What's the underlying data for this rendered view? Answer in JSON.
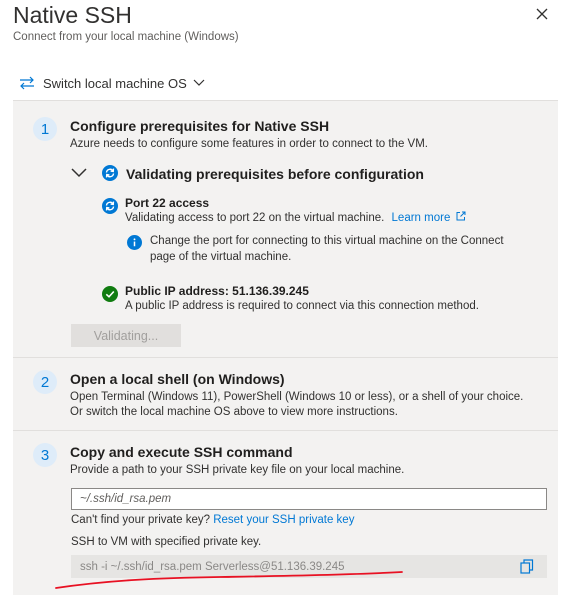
{
  "header": {
    "title": "Native SSH",
    "subtitle": "Connect from your local machine (Windows)"
  },
  "switch_os": {
    "label": "Switch local machine OS"
  },
  "steps": [
    {
      "number": "1",
      "title": "Configure prerequisites for Native SSH",
      "description": "Azure needs to configure some features in order to connect to the VM.",
      "validation": {
        "title": "Validating prerequisites before configuration",
        "port": {
          "title": "Port 22 access",
          "description": "Validating access to port 22 on the virtual machine.",
          "learn_more": "Learn more",
          "info_line1": "Change the port for connecting to this virtual machine on the Connect",
          "info_line2": "page of the virtual machine."
        },
        "public_ip": {
          "title": "Public IP address: 51.136.39.245",
          "description": "A public IP address is required to connect via this connection method."
        }
      },
      "button_label": "Validating..."
    },
    {
      "number": "2",
      "title": "Open a local shell (on Windows)",
      "line1": "Open Terminal (Windows 11), PowerShell (Windows 10 or less), or a shell of your choice.",
      "line2": "Or switch the local machine OS above to view more instructions."
    },
    {
      "number": "3",
      "title": "Copy and execute SSH command",
      "description": "Provide a path to your SSH private key file on your local machine.",
      "key_path_value": "~/.ssh/id_rsa.pem",
      "cant_find_text": "Can't find your private key?",
      "reset_link": "Reset your SSH private key",
      "ssh_label": "SSH to VM with specified private key.",
      "command": "ssh -i ~/.ssh/id_rsa.pem Serverless@51.136.39.245"
    }
  ],
  "colors": {
    "accent": "#0078d4",
    "success": "#107c10",
    "panel_background": "#f3f2f1",
    "annotation_red": "#e81123"
  },
  "icons": {
    "close": "close-icon",
    "switch": "swap-arrows-icon",
    "chevron": "chevron-down-icon",
    "validating": "sync-icon",
    "info": "info-icon",
    "success": "checkmark-circle-icon",
    "external": "external-link-icon",
    "copy": "copy-icon"
  }
}
